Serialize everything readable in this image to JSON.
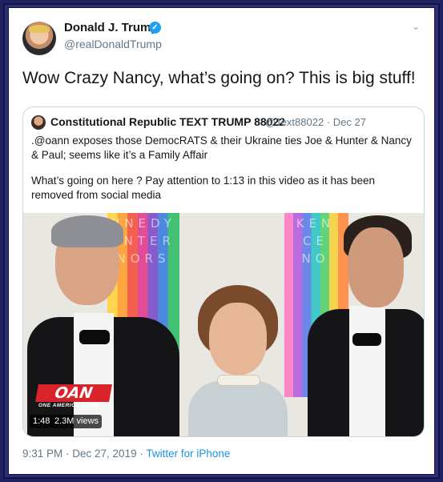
{
  "author": {
    "name": "Donald J. Trump",
    "handle": "@realDonaldTrump",
    "verified": true
  },
  "tweet": {
    "text": "Wow Crazy Nancy, what’s going on? This is big stuff!",
    "timestamp": "9:31 PM · Dec 27, 2019 · ",
    "source": "Twitter for iPhone"
  },
  "quoted": {
    "name": "Constitutional Republic TEXT TRUMP 88022",
    "handle_date": "@Text88022 · Dec 27",
    "paragraphs": [
      ".@oann exposes those DemocRATS & their Ukraine ties Joe & Hunter & Nancy & Paul; seems like it’s a Family Affair",
      "What’s going on here ? Pay attention to 1:13 in this video as it has been removed from social media"
    ],
    "media": {
      "duration": "1:48",
      "views": "2.3M views",
      "logo_text": "OAN",
      "logo_subtext": "ONE AMERICA NEWS",
      "wall_text_left": "NNEDY ENTER NORS",
      "wall_text_right": "KEN CE NO"
    }
  },
  "colors": {
    "frame": "#2b2f78",
    "link": "#1b95e0",
    "verified": "#1da1f2"
  },
  "icons": {
    "verified": "check-badge-icon",
    "caret": "chevron-down-icon"
  }
}
